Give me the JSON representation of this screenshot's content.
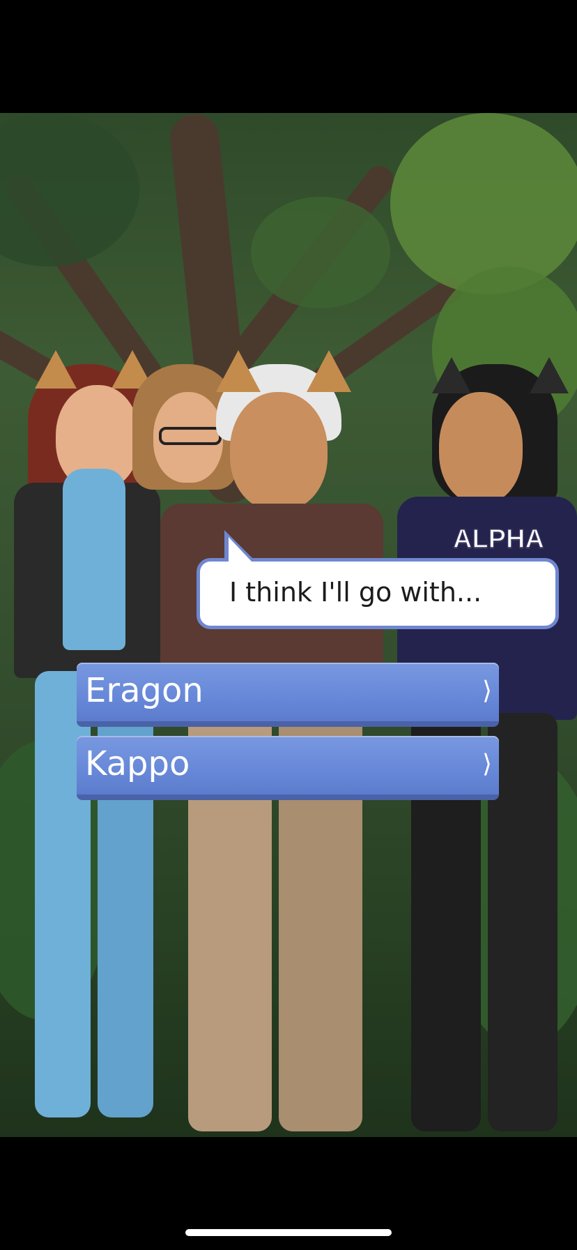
{
  "scene": {
    "speaker_name": "ALPHA",
    "dialogue": "I think I'll go with..."
  },
  "choices": [
    {
      "label": "Eragon",
      "chevron": "⟩"
    },
    {
      "label": "Kappo",
      "chevron": "⟩"
    }
  ],
  "colors": {
    "bubble_border": "#6f87cf",
    "choice_fill": "#6788d8",
    "letterbox": "#000000"
  }
}
